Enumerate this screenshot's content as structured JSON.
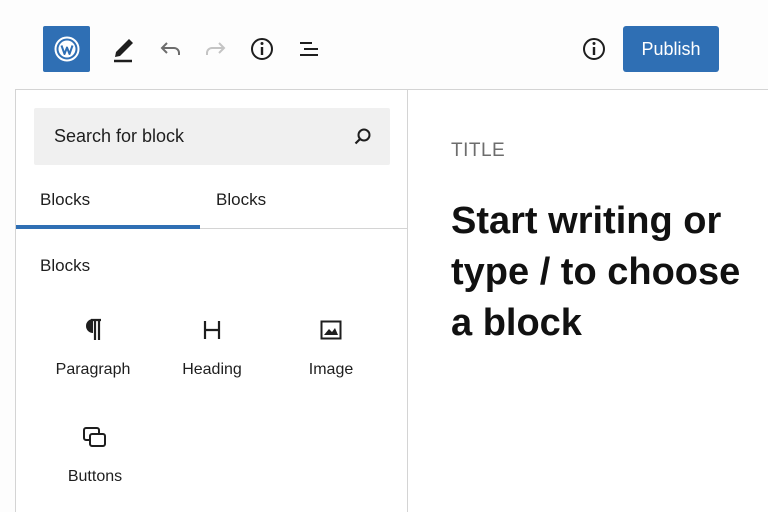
{
  "toolbar": {
    "logo_icon": "wordpress-logo-icon",
    "tools": [
      {
        "name": "edit-pencil-icon"
      },
      {
        "name": "undo-icon"
      },
      {
        "name": "redo-icon"
      },
      {
        "name": "info-icon"
      },
      {
        "name": "list-view-icon"
      }
    ],
    "publish_label": "Publish"
  },
  "inserter": {
    "search": {
      "placeholder": "Search for block"
    },
    "tabs": [
      {
        "label": "Blocks",
        "active": true
      },
      {
        "label": "Blocks",
        "active": false
      }
    ],
    "section_title": "Blocks",
    "blocks": [
      {
        "label": "Paragraph",
        "icon": "paragraph-icon"
      },
      {
        "label": "Heading",
        "icon": "heading-icon"
      },
      {
        "label": "Image",
        "icon": "image-icon"
      },
      {
        "label": "Buttons",
        "icon": "buttons-icon"
      }
    ]
  },
  "editor": {
    "title_placeholder": "TITLE",
    "body_placeholder": "Start writing or type / to choose a block"
  },
  "colors": {
    "accent": "#2f6fb4",
    "text": "#1e1e1e",
    "muted": "#6d6d6d",
    "search_bg": "#f0f0f0",
    "border": "#d4d4d4"
  }
}
